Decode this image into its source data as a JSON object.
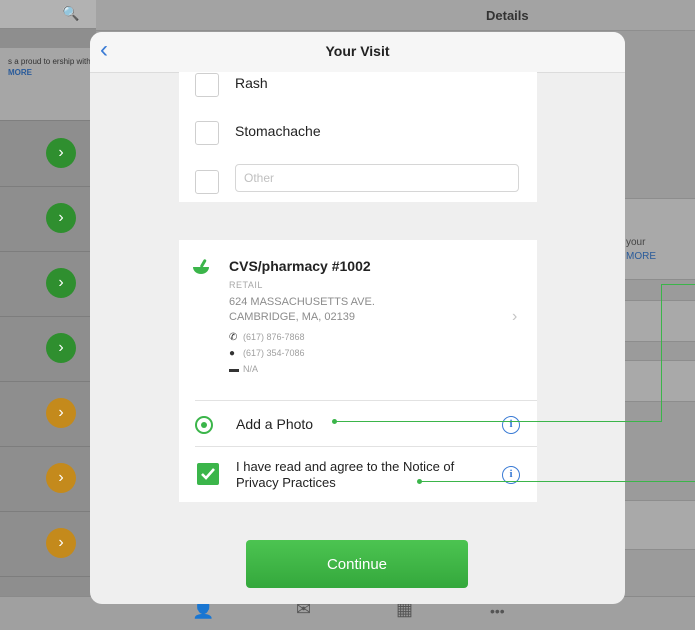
{
  "background": {
    "search_icon": "🔍",
    "promo_text": "s a proud to ership with",
    "promo_more": "MORE",
    "topbar_title": "Details",
    "card_text": "your",
    "card_more": "MORE",
    "row_icon_glyph": "›",
    "row_colors": [
      "#2f8f2f",
      "#2f8f2f",
      "#2f8f2f",
      "#2f8f2f",
      "#c48a1c",
      "#c48a1c",
      "#c48a1c"
    ]
  },
  "modal": {
    "back_glyph": "‹",
    "title": "Your Visit",
    "symptoms": [
      {
        "label": "Rash"
      },
      {
        "label": "Stomachache"
      }
    ],
    "other_placeholder": "Other",
    "pharmacy": {
      "name": "CVS/pharmacy #1002",
      "type": "RETAIL",
      "address_line1": "624 MASSACHUSETTS AVE.",
      "address_line2": "CAMBRIDGE, MA, 02139",
      "phone": "(617) 876-7868",
      "fax": "(617) 354-7086",
      "email": "N/A",
      "chevron": "›"
    },
    "add_photo_label": "Add a Photo",
    "agree_text": "I have read and agree to the Notice of Privacy Practices",
    "info_glyph": "i",
    "continue_label": "Continue"
  },
  "tabbar": {
    "icons": [
      "👤",
      "✉",
      "▦",
      "•••"
    ]
  },
  "colors": {
    "accent_green": "#3bb54a",
    "link_blue": "#3a7bd5"
  }
}
